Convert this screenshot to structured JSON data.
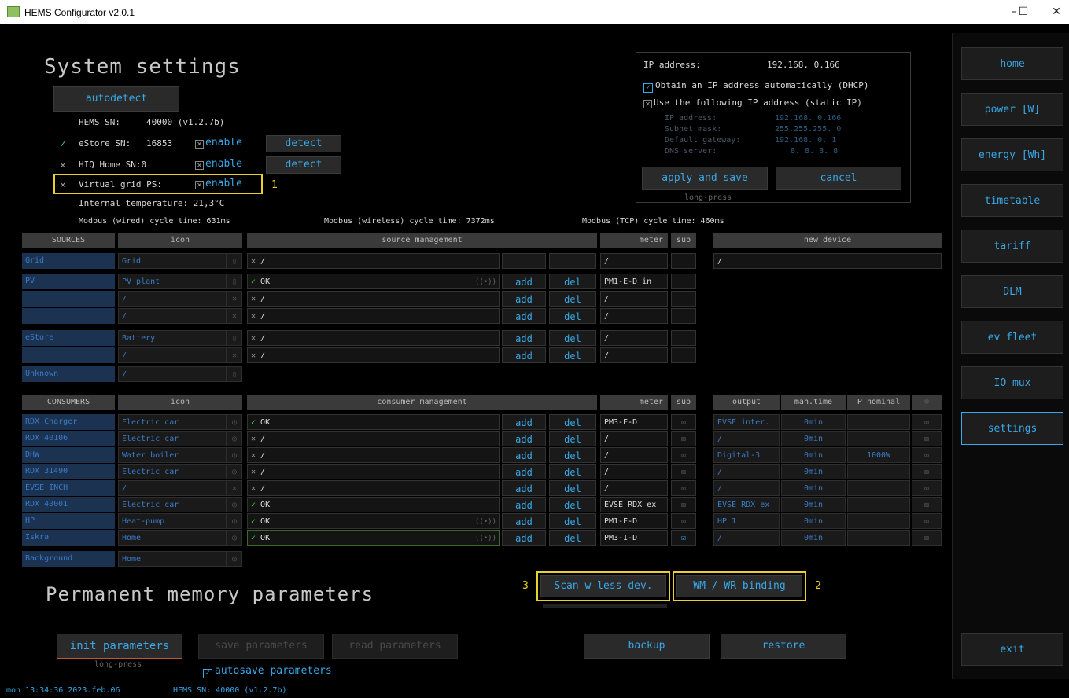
{
  "window": {
    "title": "HEMS Configurator v2.0.1",
    "minimize": "–",
    "maximize": "☐",
    "close": "✕"
  },
  "system": {
    "title": "System settings",
    "autodetect": "autodetect",
    "hems_sn_label": "HEMS SN:",
    "hems_sn_value": "40000 (v1.2.7b)",
    "estore_check": "✓",
    "estore_label": "eStore SN:",
    "estore_value": "16853",
    "estore_enable": "enable",
    "estore_detect": "detect",
    "hiq_x": "✕",
    "hiq_label": "HIQ Home SN:0",
    "hiq_enable": "enable",
    "hiq_detect": "detect",
    "vg_x": "✕",
    "vg_label": "Virtual grid PS:",
    "vg_enable": "enable",
    "vg_marker": "1",
    "internal_temp": "Internal temperature: 21,3°C",
    "modbus_wired": "Modbus (wired) cycle time: 631ms",
    "modbus_wireless": "Modbus (wireless) cycle time: 7372ms",
    "modbus_tcp": "Modbus (TCP) cycle time: 460ms"
  },
  "ip": {
    "label": "IP address:",
    "value": "192.168.  0.166",
    "dhcp_label": "Obtain an IP address automatically (DHCP)",
    "static_label": "Use the following IP address (static IP)",
    "f_ip_label": "IP address:",
    "f_ip_value": "192.168.  0.166",
    "f_mask_label": "Subnet mask:",
    "f_mask_value": "255.255.255.  0",
    "f_gw_label": "Default gateway:",
    "f_gw_value": "192.168.  0.  1",
    "f_dns_label": "DNS server:",
    "f_dns_value": "8.  8.  8.  8",
    "apply": "apply and save",
    "cancel": "cancel",
    "longpress": "long-press"
  },
  "sources": {
    "headers": {
      "name": "SOURCES",
      "icon": "icon",
      "mgmt": "source management",
      "meter": "meter",
      "sub": "sub",
      "new": "new device"
    },
    "new_device_value": "/",
    "rows": [
      {
        "name": "Grid",
        "icon": "Grid",
        "mgmt_mark": "✕",
        "mgmt": "/",
        "add": "",
        "del": "",
        "meter": "/",
        "sub": ""
      },
      {
        "name": "PV",
        "icon": "PV plant",
        "mgmt_mark": "✓",
        "mgmt": "OK",
        "add": "add",
        "del": "del",
        "meter": "PM1-E-D  in",
        "sub": ""
      },
      {
        "name": "",
        "icon": "/",
        "mgmt_mark": "✕",
        "mgmt": "/",
        "add": "add",
        "del": "del",
        "meter": "/",
        "sub": ""
      },
      {
        "name": "",
        "icon": "/",
        "mgmt_mark": "✕",
        "mgmt": "/",
        "add": "add",
        "del": "del",
        "meter": "/",
        "sub": ""
      },
      {
        "name": "eStore",
        "icon": "Battery",
        "mgmt_mark": "✕",
        "mgmt": "/",
        "add": "add",
        "del": "del",
        "meter": "/",
        "sub": ""
      },
      {
        "name": "",
        "icon": "/",
        "mgmt_mark": "✕",
        "mgmt": "/",
        "add": "add",
        "del": "del",
        "meter": "/",
        "sub": ""
      },
      {
        "name": "Unknown",
        "icon": "/"
      }
    ]
  },
  "consumers": {
    "headers": {
      "name": "CONSUMERS",
      "icon": "icon",
      "mgmt": "consumer management",
      "meter": "meter",
      "sub": "sub",
      "output": "output",
      "mantime": "man.time",
      "pnom": "P nominal"
    },
    "rows": [
      {
        "name": "RDX Charger",
        "icon": "Electric car",
        "mark": "✓",
        "mgmt": "OK",
        "meter": "PM3-E-D",
        "output": "EVSE inter.",
        "mantime": "0min",
        "pnom": ""
      },
      {
        "name": "RDX 40106",
        "icon": "Electric car",
        "mark": "✕",
        "mgmt": "/",
        "meter": "/",
        "output": "/",
        "mantime": "0min",
        "pnom": ""
      },
      {
        "name": "DHW",
        "icon": "Water boiler",
        "mark": "✕",
        "mgmt": "/",
        "meter": "/",
        "output": "Digital-3",
        "mantime": "0min",
        "pnom": "1000W"
      },
      {
        "name": "RDX 31490",
        "icon": "Electric car",
        "mark": "✕",
        "mgmt": "/",
        "meter": "/",
        "output": "/",
        "mantime": "0min",
        "pnom": ""
      },
      {
        "name": "EVSE INCH",
        "icon": "/",
        "mark": "✕",
        "mgmt": "/",
        "meter": "/",
        "output": "/",
        "mantime": "0min",
        "pnom": ""
      },
      {
        "name": "RDX 40001",
        "icon": "Electric car",
        "mark": "✓",
        "mgmt": "OK",
        "meter": "EVSE RDX ex",
        "output": "EVSE RDX ex",
        "mantime": "0min",
        "pnom": ""
      },
      {
        "name": "HP",
        "icon": "Heat-pump",
        "mark": "✓",
        "mgmt": "OK",
        "meter": "PM1-E-D",
        "output": "HP 1",
        "mantime": "0min",
        "pnom": ""
      },
      {
        "name": "Iskra",
        "icon": "Home",
        "mark": "✓",
        "mgmt": "OK",
        "meter": "PM3-I-D",
        "output": "/",
        "mantime": "0min",
        "pnom": ""
      },
      {
        "name": "Background",
        "icon": "Home"
      }
    ],
    "add": "add",
    "del": "del"
  },
  "scan": {
    "label": "Scan w-less dev.",
    "marker": "3"
  },
  "binding": {
    "label": "WM / WR binding",
    "marker": "2"
  },
  "permanent": {
    "title": "Permanent memory parameters",
    "init": "init parameters",
    "init_note": "long-press",
    "save": "save parameters",
    "read": "read parameters",
    "autosave": "autosave parameters",
    "backup": "backup",
    "restore": "restore"
  },
  "nav": [
    "home",
    "power [W]",
    "energy [Wh]",
    "timetable",
    "tariff",
    "DLM",
    "ev fleet",
    "IO mux",
    "settings"
  ],
  "exit": "exit",
  "status": {
    "datetime": "mon 13:34:36 2023.feb.06",
    "sn": "HEMS SN: 40000 (v1.2.7b)"
  }
}
